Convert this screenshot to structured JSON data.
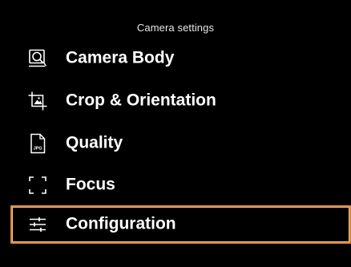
{
  "header": {
    "title": "Camera settings"
  },
  "menu": {
    "items": [
      {
        "label": "Camera Body",
        "icon": "camera-body-icon"
      },
      {
        "label": "Crop & Orientation",
        "icon": "crop-icon"
      },
      {
        "label": "Quality",
        "icon": "jpg-file-icon",
        "icon_text": "JPG"
      },
      {
        "label": "Focus",
        "icon": "focus-frame-icon"
      },
      {
        "label": "Configuration",
        "icon": "sliders-icon",
        "selected": true
      }
    ]
  },
  "colors": {
    "background": "#000000",
    "text": "#ffffff",
    "selection_border": "#d9853a"
  }
}
